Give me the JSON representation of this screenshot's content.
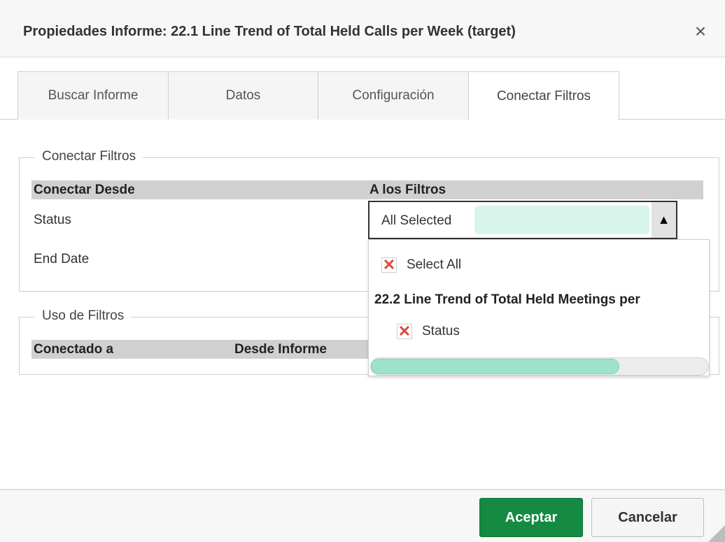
{
  "dialog": {
    "title": "Propiedades Informe: 22.1 Line Trend of Total Held Calls per Week (target)",
    "close_glyph": "×"
  },
  "tabs": [
    {
      "label": "Buscar Informe",
      "active": false
    },
    {
      "label": "Datos",
      "active": false
    },
    {
      "label": "Configuración",
      "active": false
    },
    {
      "label": "Conectar Filtros",
      "active": true
    }
  ],
  "connect_filters": {
    "legend": "Conectar Filtros",
    "col_from": "Conectar Desde",
    "col_to": "A los Filtros",
    "rows": [
      {
        "label": "Status"
      },
      {
        "label": "End Date"
      }
    ],
    "select": {
      "value": "All Selected",
      "arrow_glyph": "▲",
      "fill_color": "#d8f5ec"
    }
  },
  "dropdown": {
    "select_all_label": "Select All",
    "check_glyph": "✕",
    "group_label": "22.2 Line Trend of Total Held Meetings per",
    "items": [
      {
        "label": "Status",
        "checked": true
      }
    ],
    "scroll_fraction": 0.74,
    "thumb_color": "#9de3cb"
  },
  "filter_usage": {
    "legend": "Uso de Filtros",
    "col_connected": "Conectado a",
    "col_from_report": "Desde Informe"
  },
  "footer": {
    "ok_label": "Aceptar",
    "cancel_label": "Cancelar"
  },
  "colors": {
    "accept_button": "#148a43",
    "header_bg": "#f7f7f7",
    "column_header_bg": "#d0d0d0",
    "x_mark": "#e0463d"
  }
}
